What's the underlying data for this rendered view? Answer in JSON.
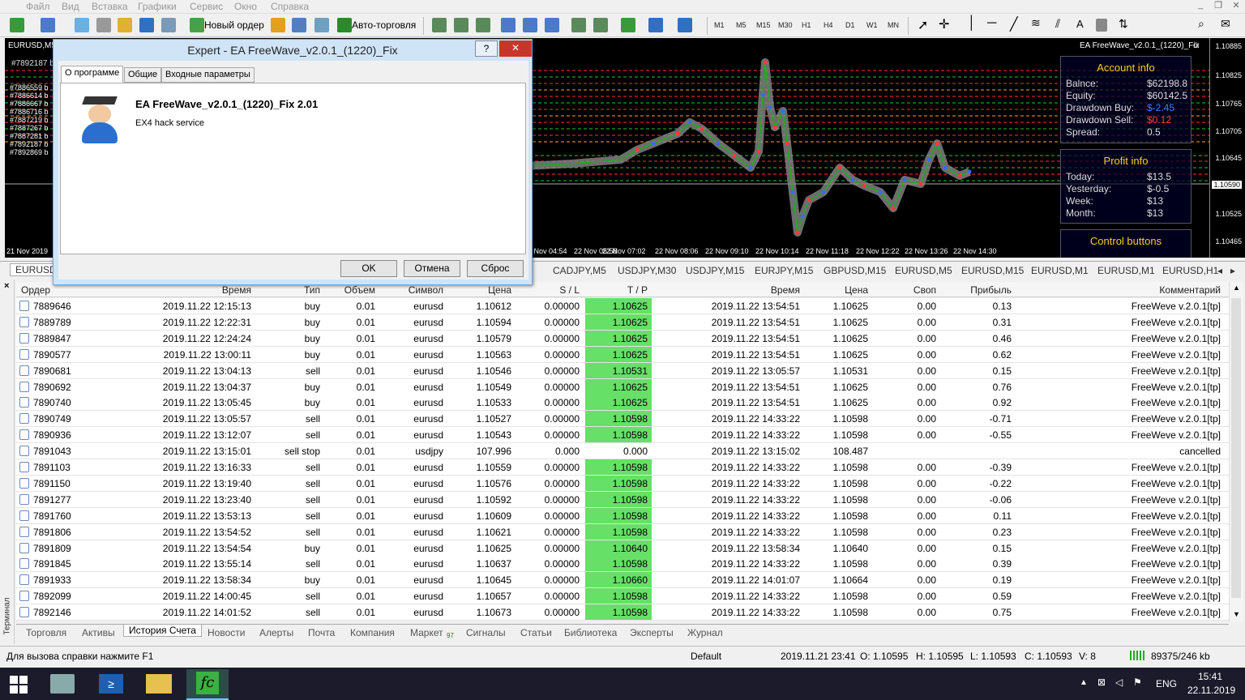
{
  "menu": {
    "items": [
      "Файл",
      "Вид",
      "Вставка",
      "Графики",
      "Сервис",
      "Окно",
      "Справка"
    ]
  },
  "toolbar": {
    "new_order": "Новый ордер",
    "auto_trading": "Авто-торговля",
    "timeframes": [
      "M1",
      "M5",
      "M15",
      "M30",
      "H1",
      "H4",
      "D1",
      "W1",
      "MN"
    ]
  },
  "chart": {
    "symbol_label": "EURUSD,M5",
    "ea_label": "EA FreeWave_v2.0.1_(1220)_Fix",
    "order_tag": "#7892187 b",
    "order_tags_left": [
      "#7886559 b",
      "#7886614 b",
      "#7886667 b",
      "#7886716 b",
      "#7887219 b",
      "#7887267 b",
      "#7887281 b",
      "#7892187 b",
      "#7892869 b"
    ],
    "time_labels": [
      "21 Nov 2019",
      "22 Nov 04:54",
      "22 Nov 05:58",
      "22 Nov 07:02",
      "22 Nov 08:06",
      "22 Nov 09:10",
      "22 Nov 10:14",
      "22 Nov 11:18",
      "22 Nov 12:22",
      "22 Nov 13:26",
      "22 Nov 14:30"
    ],
    "price_labels": [
      "1.10885",
      "1.10825",
      "1.10765",
      "1.10705",
      "1.10645",
      "1.10590",
      "1.10525",
      "1.10465"
    ],
    "current_price": "1.10590"
  },
  "account_info": {
    "title": "Account info",
    "rows": [
      {
        "k": "Balnce:",
        "v": "$62198.8"
      },
      {
        "k": "Equity:",
        "v": "$60142.5"
      },
      {
        "k": "Drawdown Buy:",
        "v": "$-2.45",
        "color": "#3a7cff"
      },
      {
        "k": "Drawdown Sell:",
        "v": "$0.12",
        "color": "#ff4040"
      },
      {
        "k": "Spread:",
        "v": "0.5"
      }
    ]
  },
  "profit_info": {
    "title": "Profit info",
    "rows": [
      {
        "k": "Today:",
        "v": "$13.5"
      },
      {
        "k": "Yesterday:",
        "v": "$-0.5"
      },
      {
        "k": "Week:",
        "v": "$13"
      },
      {
        "k": "Month:",
        "v": "$13"
      }
    ]
  },
  "control_buttons": "Control buttons",
  "chart_tabs": [
    "EURUSD,M5",
    "CADJPY,M5",
    "USDJPY,M30",
    "USDJPY,M15",
    "EURJPY,M15",
    "GBPUSD,M15",
    "EURUSD,M5",
    "EURUSD,M15",
    "EURUSD,M1",
    "EURUSD,M1",
    "EURUSD,H1"
  ],
  "dialog": {
    "title": "Expert - EA FreeWave_v2.0.1_(1220)_Fix",
    "help": "?",
    "close": "✕",
    "tabs": [
      "О программе",
      "Общие",
      "Входные параметры"
    ],
    "ea_name": "EA FreeWave_v2.0.1_(1220)_Fix 2.01",
    "ea_desc": "EX4 hack service",
    "ok": "OK",
    "cancel": "Отмена",
    "reset": "Сброс"
  },
  "terminal": {
    "side_label": "Терминал",
    "columns": [
      "Ордер",
      "Время",
      "Тип",
      "Объем",
      "Символ",
      "Цена",
      "S / L",
      "T / P",
      "Время",
      "Цена",
      "Своп",
      "Прибыль",
      "Комментарий"
    ],
    "rows": [
      [
        "7889646",
        "2019.11.22 12:15:13",
        "buy",
        "0.01",
        "eurusd",
        "1.10612",
        "0.00000",
        "1.10625",
        "2019.11.22 13:54:51",
        "1.10625",
        "0.00",
        "0.13",
        "FreeWeve v.2.0.1[tp]"
      ],
      [
        "7889789",
        "2019.11.22 12:22:31",
        "buy",
        "0.01",
        "eurusd",
        "1.10594",
        "0.00000",
        "1.10625",
        "2019.11.22 13:54:51",
        "1.10625",
        "0.00",
        "0.31",
        "FreeWeve v.2.0.1[tp]"
      ],
      [
        "7889847",
        "2019.11.22 12:24:24",
        "buy",
        "0.01",
        "eurusd",
        "1.10579",
        "0.00000",
        "1.10625",
        "2019.11.22 13:54:51",
        "1.10625",
        "0.00",
        "0.46",
        "FreeWeve v.2.0.1[tp]"
      ],
      [
        "7890577",
        "2019.11.22 13:00:11",
        "buy",
        "0.01",
        "eurusd",
        "1.10563",
        "0.00000",
        "1.10625",
        "2019.11.22 13:54:51",
        "1.10625",
        "0.00",
        "0.62",
        "FreeWeve v.2.0.1[tp]"
      ],
      [
        "7890681",
        "2019.11.22 13:04:13",
        "sell",
        "0.01",
        "eurusd",
        "1.10546",
        "0.00000",
        "1.10531",
        "2019.11.22 13:05:57",
        "1.10531",
        "0.00",
        "0.15",
        "FreeWeve v.2.0.1[tp]"
      ],
      [
        "7890692",
        "2019.11.22 13:04:37",
        "buy",
        "0.01",
        "eurusd",
        "1.10549",
        "0.00000",
        "1.10625",
        "2019.11.22 13:54:51",
        "1.10625",
        "0.00",
        "0.76",
        "FreeWeve v.2.0.1[tp]"
      ],
      [
        "7890740",
        "2019.11.22 13:05:45",
        "buy",
        "0.01",
        "eurusd",
        "1.10533",
        "0.00000",
        "1.10625",
        "2019.11.22 13:54:51",
        "1.10625",
        "0.00",
        "0.92",
        "FreeWeve v.2.0.1[tp]"
      ],
      [
        "7890749",
        "2019.11.22 13:05:57",
        "sell",
        "0.01",
        "eurusd",
        "1.10527",
        "0.00000",
        "1.10598",
        "2019.11.22 14:33:22",
        "1.10598",
        "0.00",
        "-0.71",
        "FreeWeve v.2.0.1[tp]"
      ],
      [
        "7890936",
        "2019.11.22 13:12:07",
        "sell",
        "0.01",
        "eurusd",
        "1.10543",
        "0.00000",
        "1.10598",
        "2019.11.22 14:33:22",
        "1.10598",
        "0.00",
        "-0.55",
        "FreeWeve v.2.0.1[tp]"
      ],
      [
        "7891043",
        "2019.11.22 13:15:01",
        "sell stop",
        "0.01",
        "usdjpy",
        "107.996",
        "0.000",
        "0.000",
        "2019.11.22 13:15:02",
        "108.487",
        "",
        "",
        "cancelled"
      ],
      [
        "7891103",
        "2019.11.22 13:16:33",
        "sell",
        "0.01",
        "eurusd",
        "1.10559",
        "0.00000",
        "1.10598",
        "2019.11.22 14:33:22",
        "1.10598",
        "0.00",
        "-0.39",
        "FreeWeve v.2.0.1[tp]"
      ],
      [
        "7891150",
        "2019.11.22 13:19:40",
        "sell",
        "0.01",
        "eurusd",
        "1.10576",
        "0.00000",
        "1.10598",
        "2019.11.22 14:33:22",
        "1.10598",
        "0.00",
        "-0.22",
        "FreeWeve v.2.0.1[tp]"
      ],
      [
        "7891277",
        "2019.11.22 13:23:40",
        "sell",
        "0.01",
        "eurusd",
        "1.10592",
        "0.00000",
        "1.10598",
        "2019.11.22 14:33:22",
        "1.10598",
        "0.00",
        "-0.06",
        "FreeWeve v.2.0.1[tp]"
      ],
      [
        "7891760",
        "2019.11.22 13:53:13",
        "sell",
        "0.01",
        "eurusd",
        "1.10609",
        "0.00000",
        "1.10598",
        "2019.11.22 14:33:22",
        "1.10598",
        "0.00",
        "0.11",
        "FreeWeve v.2.0.1[tp]"
      ],
      [
        "7891806",
        "2019.11.22 13:54:52",
        "sell",
        "0.01",
        "eurusd",
        "1.10621",
        "0.00000",
        "1.10598",
        "2019.11.22 14:33:22",
        "1.10598",
        "0.00",
        "0.23",
        "FreeWeve v.2.0.1[tp]"
      ],
      [
        "7891809",
        "2019.11.22 13:54:54",
        "buy",
        "0.01",
        "eurusd",
        "1.10625",
        "0.00000",
        "1.10640",
        "2019.11.22 13:58:34",
        "1.10640",
        "0.00",
        "0.15",
        "FreeWeve v.2.0.1[tp]"
      ],
      [
        "7891845",
        "2019.11.22 13:55:14",
        "sell",
        "0.01",
        "eurusd",
        "1.10637",
        "0.00000",
        "1.10598",
        "2019.11.22 14:33:22",
        "1.10598",
        "0.00",
        "0.39",
        "FreeWeve v.2.0.1[tp]"
      ],
      [
        "7891933",
        "2019.11.22 13:58:34",
        "buy",
        "0.01",
        "eurusd",
        "1.10645",
        "0.00000",
        "1.10660",
        "2019.11.22 14:01:07",
        "1.10664",
        "0.00",
        "0.19",
        "FreeWeve v.2.0.1[tp]"
      ],
      [
        "7892099",
        "2019.11.22 14:00:45",
        "sell",
        "0.01",
        "eurusd",
        "1.10657",
        "0.00000",
        "1.10598",
        "2019.11.22 14:33:22",
        "1.10598",
        "0.00",
        "0.59",
        "FreeWeve v.2.0.1[tp]"
      ],
      [
        "7892146",
        "2019.11.22 14:01:52",
        "sell",
        "0.01",
        "eurusd",
        "1.10673",
        "0.00000",
        "1.10598",
        "2019.11.22 14:33:22",
        "1.10598",
        "0.00",
        "0.75",
        "FreeWeve v.2.0.1[tp]"
      ]
    ],
    "tabs": [
      "Торговля",
      "Активы",
      "История Счета",
      "Новости",
      "Алерты",
      "Почта",
      "Компания",
      "Маркет",
      "Сигналы",
      "Статьи",
      "Библиотека",
      "Эксперты",
      "Журнал"
    ],
    "market_badge": "97",
    "active_tab": "История Счета"
  },
  "status": {
    "help": "Для вызова справки нажмите F1",
    "profile": "Default",
    "datetime": "2019.11.21 23:41",
    "open": "O: 1.10595",
    "high": "H: 1.10595",
    "low": "L: 1.10593",
    "close": "C: 1.10593",
    "volume": "V: 8",
    "traffic": "89375/246 kb"
  },
  "taskbar": {
    "lang": "ENG",
    "time": "15:41",
    "date": "22.11.2019"
  },
  "colors": {
    "tp_green": "#66e066",
    "chart_bg": "#000000"
  }
}
